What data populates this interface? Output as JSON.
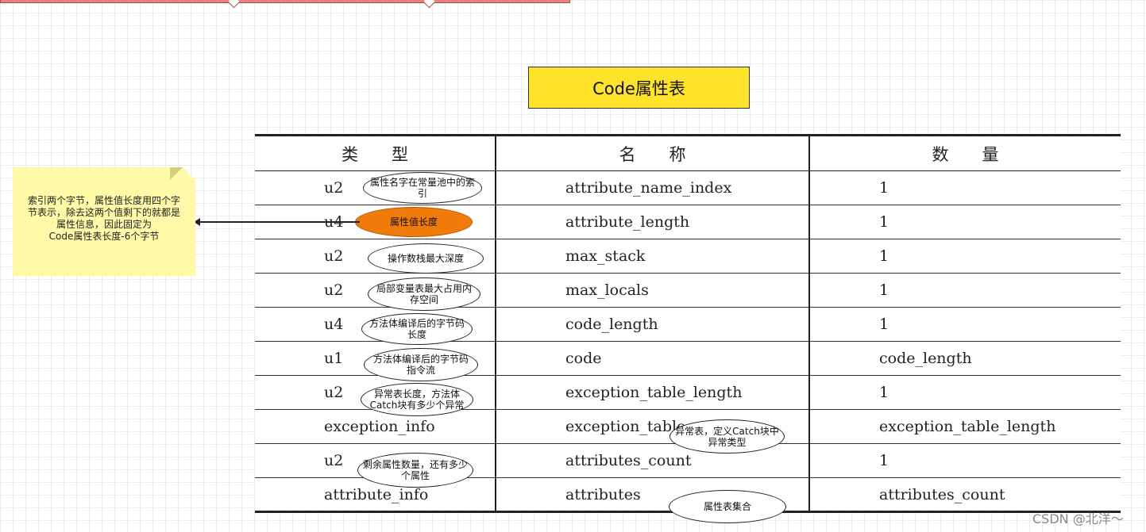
{
  "title": "Code属性表",
  "table": {
    "headers": [
      "类　　型",
      "名　　称",
      "数　　量"
    ],
    "rows": [
      {
        "type": "u2",
        "name": "attribute_name_index",
        "count": "1"
      },
      {
        "type": "u4",
        "name": "attribute_length",
        "count": "1"
      },
      {
        "type": "u2",
        "name": "max_stack",
        "count": "1"
      },
      {
        "type": "u2",
        "name": "max_locals",
        "count": "1"
      },
      {
        "type": "u4",
        "name": "code_length",
        "count": "1"
      },
      {
        "type": "u1",
        "name": "code",
        "count": "code_length"
      },
      {
        "type": "u2",
        "name": "exception_table_length",
        "count": "1"
      },
      {
        "type": "exception_info",
        "name": "exception_table",
        "count": "exception_table_length"
      },
      {
        "type": "u2",
        "name": "attributes_count",
        "count": "1"
      },
      {
        "type": "attribute_info",
        "name": "attributes",
        "count": "attributes_count"
      }
    ]
  },
  "clouds": {
    "attribute_name_index": "属性名字在常量池中的索引",
    "attribute_length": "属性值长度",
    "max_stack": "操作数栈最大深度",
    "max_locals": "局部变量表最大占用内存空间",
    "code_length": "方法体编译后的字节码长度",
    "code": "方法体编译后的字节码指令流",
    "exception_table_length": "异常表长度，方法体Catch块有多少个异常",
    "exception_table": "异常表，定义Catch块中异常类型",
    "attributes_count": "剩余属性数量，还有多少个属性",
    "attributes": "属性表集合"
  },
  "note": {
    "lines": [
      "索引两个字节，属性值长度用四个字",
      "节表示，除去这两个值剩下的就都是",
      "属性信息，因此固定为",
      "Code属性表长度-6个字节"
    ]
  },
  "colors": {
    "title_bg": "#ffe32a",
    "note_bg": "#fff9a8",
    "highlight_cloud": "#f07b0a",
    "top_bar": "#e6817c"
  },
  "watermark": "CSDN @北洋～"
}
